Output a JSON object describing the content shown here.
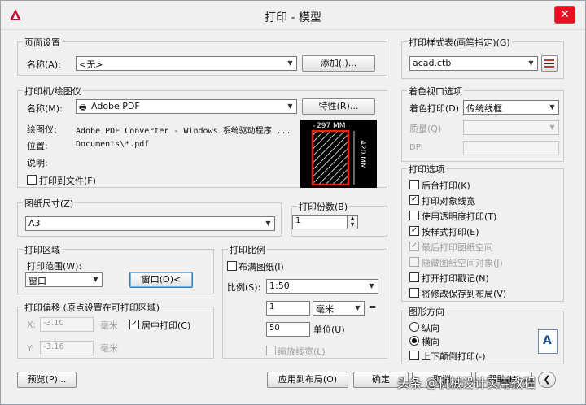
{
  "title": "打印 - 模型",
  "page_setup": {
    "group": "页面设置",
    "name_label": "名称(A):",
    "name_value": "<无>",
    "add_button": "添加(.)..."
  },
  "printer": {
    "group": "打印机/绘图仪",
    "name_label": "名称(M):",
    "name_value": "Adobe PDF",
    "properties_button": "特性(R)...",
    "plotter_label": "绘图仪:",
    "plotter_value": "Adobe PDF Converter - Windows 系统驱动程序 ...",
    "where_label": "位置:",
    "where_value": "Documents\\*.pdf",
    "desc_label": "说明:",
    "print_to_file": "打印到文件(F)",
    "preview_width": "297 MM",
    "preview_height": "420 MM"
  },
  "paper_size": {
    "group": "图纸尺寸(Z)",
    "value": "A3"
  },
  "copies": {
    "group": "打印份数(B)",
    "value": "1"
  },
  "plot_area": {
    "group": "打印区域",
    "range_label": "打印范围(W):",
    "range_value": "窗口",
    "window_button": "窗口(O)<"
  },
  "plot_offset": {
    "group": "打印偏移 (原点设置在可打印区域)",
    "x_label": "X:",
    "x_value": "-3.10",
    "y_label": "Y:",
    "y_value": "-3.16",
    "unit": "毫米",
    "center": "居中打印(C)"
  },
  "plot_scale": {
    "group": "打印比例",
    "fit_paper": "布满图纸(I)",
    "scale_label": "比例(S):",
    "scale_value": "1:50",
    "value1": "1",
    "unit_value": "毫米",
    "equals": "=",
    "value2": "50",
    "unit_label": "单位(U)",
    "lineweights": "缩放线宽(L)"
  },
  "plot_style": {
    "group": "打印样式表(画笔指定)(G)",
    "value": "acad.ctb"
  },
  "shaded": {
    "group": "着色视口选项",
    "shade_label": "着色打印(D)",
    "shade_value": "传统线框",
    "quality_label": "质量(Q)",
    "dpi_label": "DPI"
  },
  "options": {
    "group": "打印选项",
    "items": [
      {
        "label": "后台打印(K)",
        "checked": false,
        "disabled": false
      },
      {
        "label": "打印对象线宽",
        "checked": true,
        "disabled": false
      },
      {
        "label": "使用透明度打印(T)",
        "checked": false,
        "disabled": false
      },
      {
        "label": "按样式打印(E)",
        "checked": true,
        "disabled": false
      },
      {
        "label": "最后打印图纸空间",
        "checked": true,
        "disabled": true
      },
      {
        "label": "隐藏图纸空间对象(J)",
        "checked": false,
        "disabled": true
      },
      {
        "label": "打开打印戳记(N)",
        "checked": false,
        "disabled": false
      },
      {
        "label": "将修改保存到布局(V)",
        "checked": false,
        "disabled": false
      }
    ]
  },
  "orientation": {
    "group": "图形方向",
    "portrait": "纵向",
    "landscape": "横向",
    "upside_down": "上下颠倒打印(-)"
  },
  "footer": {
    "preview": "预览(P)...",
    "apply": "应用到布局(O)",
    "ok": "确定",
    "cancel": "取消",
    "help": "帮助(H)"
  },
  "watermark": "头条 @机械设计实用教程"
}
